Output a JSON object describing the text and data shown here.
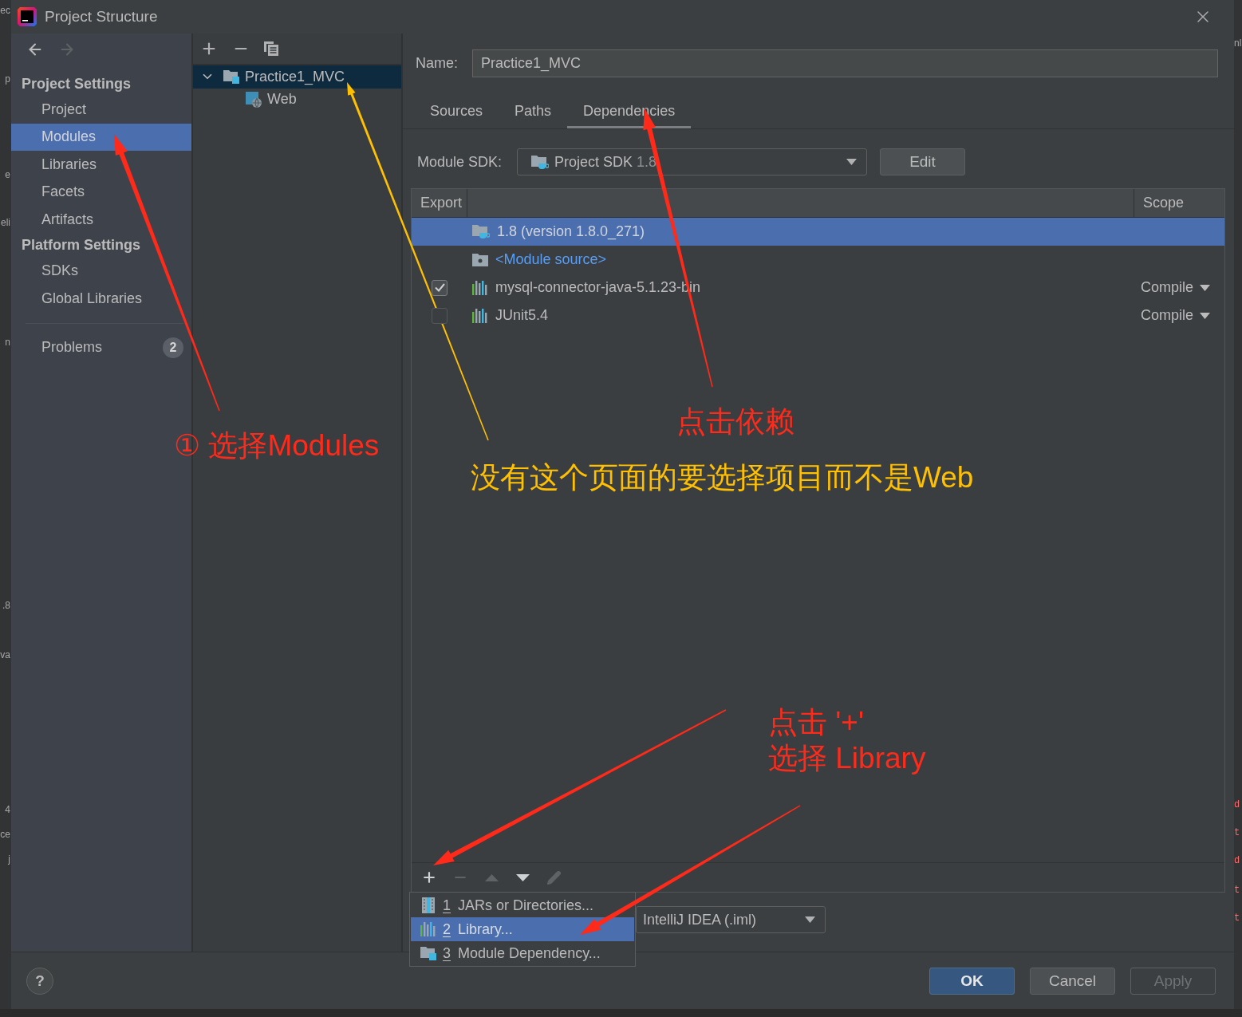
{
  "background_window": {
    "left_fragments": [
      {
        "text": "ec"
      },
      {
        "text": "p"
      },
      {
        "text": "e"
      },
      {
        "text": "eli"
      },
      {
        "text": "n"
      },
      {
        "text": ".8"
      },
      {
        "text": "va"
      },
      {
        "text": "4"
      },
      {
        "text": "ce"
      },
      {
        "text": "j"
      }
    ],
    "right_fragments": [
      {
        "text": "nl",
        "kind": "plain"
      },
      {
        "text": "d",
        "kind": "code"
      },
      {
        "text": "t",
        "kind": "code"
      },
      {
        "text": "d",
        "kind": "code"
      },
      {
        "text": "t",
        "kind": "code"
      },
      {
        "text": "t",
        "kind": "code"
      }
    ]
  },
  "window": {
    "title": "Project Structure"
  },
  "navigation": {
    "back_disabled": false,
    "forward_disabled": true
  },
  "sidebar": {
    "sections": [
      {
        "title": "Project Settings",
        "items": [
          {
            "label": "Project",
            "selected": false
          },
          {
            "label": "Modules",
            "selected": true
          },
          {
            "label": "Libraries",
            "selected": false
          },
          {
            "label": "Facets",
            "selected": false
          },
          {
            "label": "Artifacts",
            "selected": false
          }
        ]
      },
      {
        "title": "Platform Settings",
        "items": [
          {
            "label": "SDKs",
            "selected": false
          },
          {
            "label": "Global Libraries",
            "selected": false
          }
        ]
      }
    ],
    "problems": {
      "label": "Problems",
      "count": "2",
      "selected": false
    }
  },
  "module_tree": {
    "items": [
      {
        "label": "Practice1_MVC",
        "kind": "module",
        "selected": true,
        "expanded": true,
        "children": [
          {
            "label": "Web",
            "kind": "web",
            "selected": false
          }
        ]
      }
    ]
  },
  "module_editor": {
    "name": {
      "label": "Name:",
      "value": "Practice1_MVC"
    },
    "tabs": [
      {
        "label": "Sources",
        "selected": false
      },
      {
        "label": "Paths",
        "selected": false
      },
      {
        "label": "Dependencies",
        "selected": true
      }
    ],
    "module_sdk": {
      "label": "Module SDK:",
      "value": "Project SDK",
      "version": "1.8"
    },
    "edit_button": {
      "label": "Edit"
    },
    "dependencies": {
      "columns": [
        {
          "label": "Export"
        },
        {
          "label": "Scope"
        }
      ],
      "rows": [
        {
          "kind": "sdk",
          "name": "1.8 (version 1.8.0_271)",
          "selected": true
        },
        {
          "kind": "source",
          "name": "<Module source>",
          "selected": false
        },
        {
          "kind": "library",
          "name": "mysql-connector-java-5.1.23-bin",
          "checked": true,
          "scope": "Compile",
          "selected": false
        },
        {
          "kind": "library",
          "name": "JUnit5.4",
          "checked": false,
          "scope": "Compile",
          "selected": false
        }
      ],
      "toolbar": [
        {
          "disabled": false
        },
        {
          "disabled": true
        },
        {
          "disabled": true
        },
        {
          "disabled": false
        },
        {
          "disabled": true
        }
      ]
    },
    "add_menu": {
      "items": [
        {
          "kind": "jars",
          "number": "1",
          "label": "JARs or Directories...",
          "selected": false
        },
        {
          "kind": "library",
          "number": "2",
          "label": "Library...",
          "selected": true
        },
        {
          "kind": "module",
          "number": "3",
          "label": "Module Dependency...",
          "selected": false
        }
      ]
    },
    "storage_format": {
      "value": "IntelliJ IDEA (.iml)"
    }
  },
  "help_button": {
    "label": "?"
  },
  "buttons": [
    {
      "label": "OK",
      "kind": "primary",
      "disabled": false
    },
    {
      "label": "Cancel",
      "kind": "normal",
      "disabled": false
    },
    {
      "label": "Apply",
      "kind": "normal",
      "disabled": true
    }
  ],
  "annotations": {
    "labels": [
      {
        "text": "点击依赖",
        "color": "#ff2a1a"
      },
      {
        "text": "① 选择Modules",
        "color": "#ff2a1a"
      },
      {
        "text": "没有这个页面的要选择项目而不是Web",
        "color": "#ffc000"
      },
      {
        "text": "点击 '+'\n选择 Library",
        "color": "#ff2a1a"
      }
    ],
    "arrows": [
      {
        "color": "#ff2a1a"
      },
      {
        "color": "#ffc000"
      },
      {
        "color": "#ff2a1a"
      },
      {
        "color": "#ff2a1a"
      },
      {
        "color": "#ff2a1a"
      }
    ]
  }
}
